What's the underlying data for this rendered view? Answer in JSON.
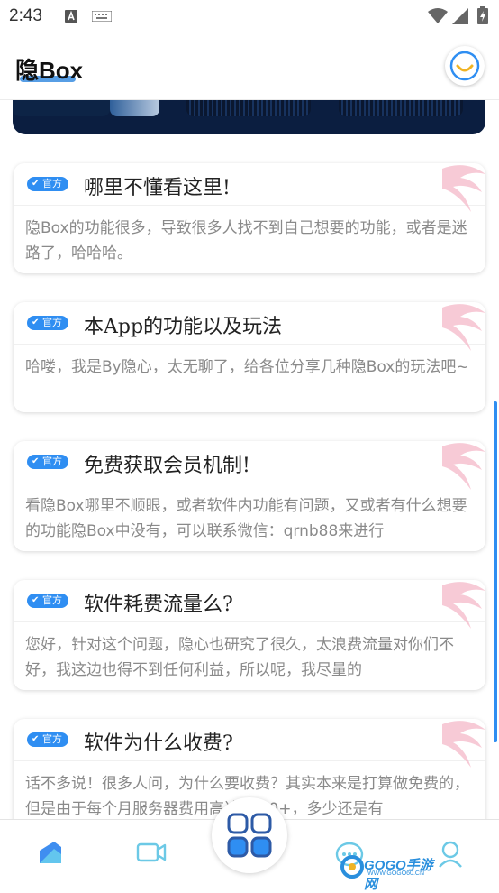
{
  "status_bar": {
    "time": "2:43"
  },
  "app_bar": {
    "title": "隐Box"
  },
  "cards": [
    {
      "badge": "官方",
      "title": "哪里不懂看这里!",
      "body": "隐Box的功能很多，导致很多人找不到自己想要的功能，或者是迷路了，哈哈哈。"
    },
    {
      "badge": "官方",
      "title": "本App的功能以及玩法",
      "body": "哈喽，我是By隐心，太无聊了，给各位分享几种隐Box的玩法吧~"
    },
    {
      "badge": "官方",
      "title": "免费获取会员机制!",
      "body": "看隐Box哪里不顺眼，或者软件内功能有问题，又或者有什么想要的功能隐Box中没有，可以联系微信：qrnb88来进行"
    },
    {
      "badge": "官方",
      "title": "软件耗费流量么?",
      "body": "您好，针对这个问题，隐心也研究了很久，太浪费流量对你们不好，我这边也得不到任何利益，所以呢，我尽量的"
    },
    {
      "badge": "官方",
      "title": "软件为什么收费?",
      "body": "话不多说！很多人问，为什么要收费？其实本来是打算做免费的，但是由于每个月服务器费用高达1000+，多少还是有"
    }
  ],
  "watermark": {
    "text": "GOGO手游网",
    "sub": "WWW.GOGO60.CN"
  },
  "colors": {
    "accent": "#2f8ef2",
    "text": "#222222",
    "muted": "#8a8a8a"
  },
  "icons": {
    "nav": [
      "home-icon",
      "video-icon",
      "apps-icon",
      "chat-icon",
      "profile-icon"
    ],
    "status": [
      "a-notification-icon",
      "keyboard-icon",
      "wifi-icon",
      "signal-icon",
      "battery-icon"
    ]
  }
}
